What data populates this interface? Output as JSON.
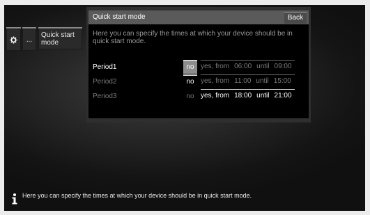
{
  "side_tabs": {
    "gear_icon": "gear-icon",
    "more_label": "...",
    "quick_start_label": "Quick start mode"
  },
  "panel": {
    "title": "Quick start mode",
    "back_label": "Back",
    "description": "Here you can specify the times at which your device should be in quick start mode."
  },
  "periods": [
    {
      "label": "Period1",
      "no_label": "no",
      "yes_label": "yes, from",
      "from": "06:00",
      "until_label": "until",
      "to": "09:00",
      "selected": "no"
    },
    {
      "label": "Period2",
      "no_label": "no",
      "yes_label": "yes, from",
      "from": "11:00",
      "until_label": "until",
      "to": "15:00",
      "selected": "no"
    },
    {
      "label": "Period3",
      "no_label": "no",
      "yes_label": "yes, from",
      "from": "18:00",
      "until_label": "until",
      "to": "21:00",
      "selected": "yes"
    }
  ],
  "info_bar": {
    "icon": "info-icon",
    "text": "Here you can specify the times at which your device should be in quick start mode."
  },
  "colors": {
    "header": "#5a5a5a",
    "focus": "#8c8c8c",
    "body": "#000000"
  }
}
